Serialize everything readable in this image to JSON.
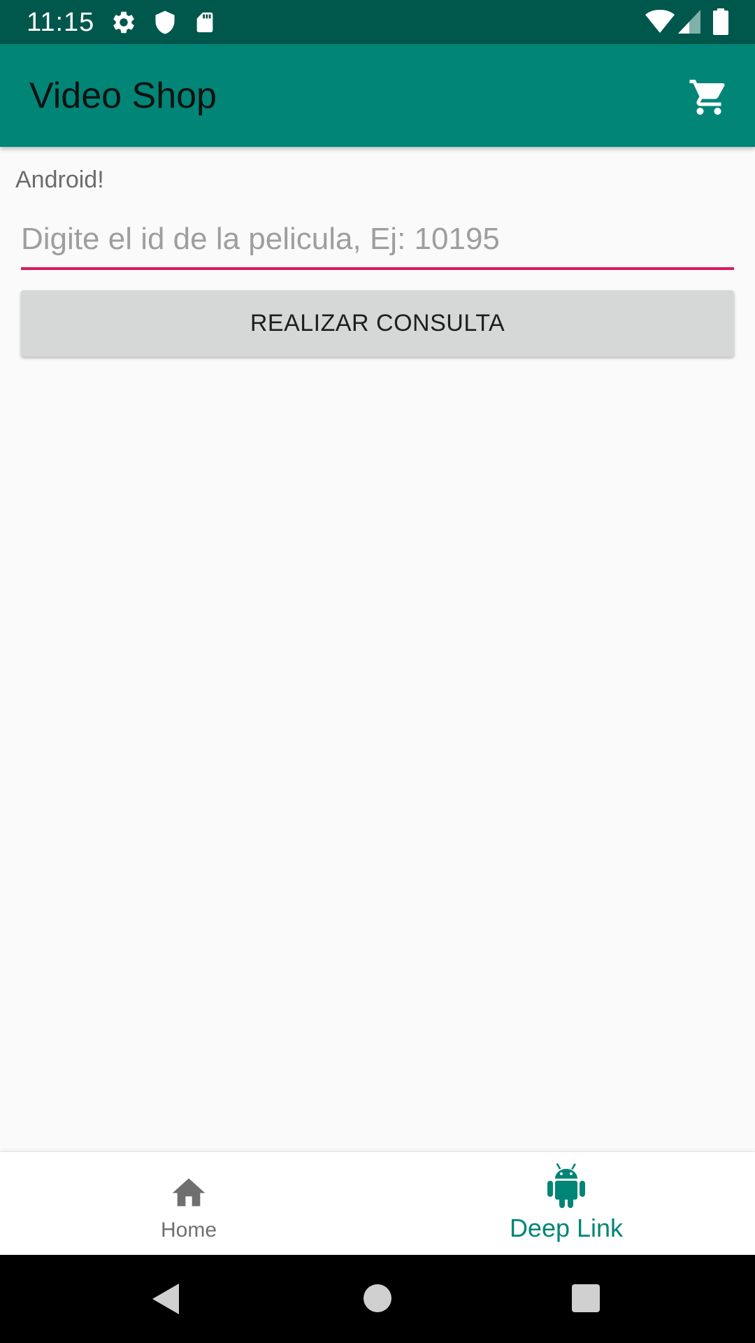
{
  "status_bar": {
    "time": "11:15",
    "icons": [
      "settings-icon",
      "shield-icon",
      "sd-card-icon",
      "wifi-icon",
      "signal-icon",
      "battery-icon"
    ]
  },
  "app_bar": {
    "title": "Video Shop",
    "action_icon": "cart-icon"
  },
  "content": {
    "label": "Android!",
    "movie_id_input": {
      "value": "",
      "placeholder": "Digite el id de la pelicula, Ej: 10195"
    },
    "query_button_label": "REALIZAR CONSULTA"
  },
  "bottom_nav": {
    "items": [
      {
        "label": "Home",
        "icon": "home-icon",
        "selected": false
      },
      {
        "label": "Deep Link",
        "icon": "android-icon",
        "selected": true
      }
    ]
  },
  "system_nav": {
    "buttons": [
      "back-icon",
      "home-circle-icon",
      "recents-icon"
    ]
  },
  "colors": {
    "status_bar": "#00574b",
    "primary": "#008577",
    "accent": "#d81b60",
    "nav_active": "#008577",
    "nav_inactive": "#6f6f6f",
    "background": "#fafafa",
    "button": "#d6d7d7"
  }
}
